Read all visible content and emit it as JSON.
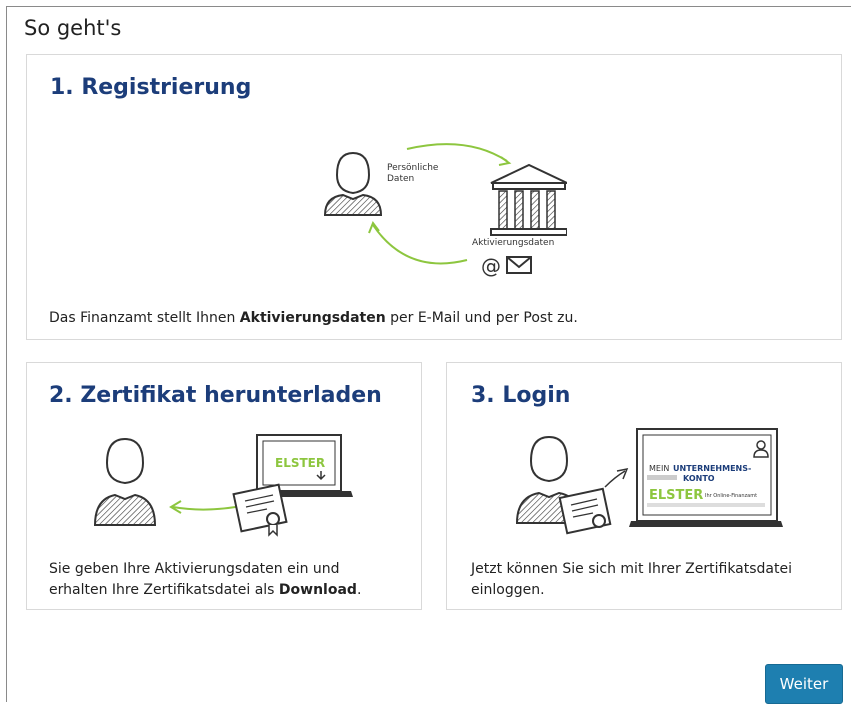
{
  "page": {
    "title": "So geht's"
  },
  "steps": [
    {
      "title": "1. Registrierung",
      "desc_pre": "Das Finanzamt stellt Ihnen ",
      "desc_bold": "Aktivierungsdaten",
      "desc_post": " per E-Mail und per Post zu.",
      "label_personal": "Persönliche",
      "label_personal2": "Daten",
      "label_activation": "Aktivierungsdaten",
      "at_symbol": "@"
    },
    {
      "title": "2. Zertifikat herunterladen",
      "desc_line1": "Sie geben Ihre Aktivierungsdaten ein und",
      "desc_line2_pre": "erhalten Ihre Zertifikatsdatei als ",
      "desc_line2_bold": "Download",
      "desc_line2_post": ".",
      "screen_text": "ELSTER"
    },
    {
      "title": "3. Login",
      "desc_line1": "Jetzt können Sie sich mit Ihrer Zertifikatsdatei",
      "desc_line2": "einloggen.",
      "screen_mein": "MEIN",
      "screen_unternehmens": "UNTERNEHMENS-",
      "screen_konto": "KONTO",
      "screen_elster": "ELSTER",
      "screen_tagline": "Ihr Online-Finanzamt"
    }
  ],
  "actions": {
    "next_label": "Weiter"
  },
  "colors": {
    "accent_green": "#8dc63f",
    "title_blue": "#1c3d7a",
    "button_blue": "#1e7fb0"
  }
}
